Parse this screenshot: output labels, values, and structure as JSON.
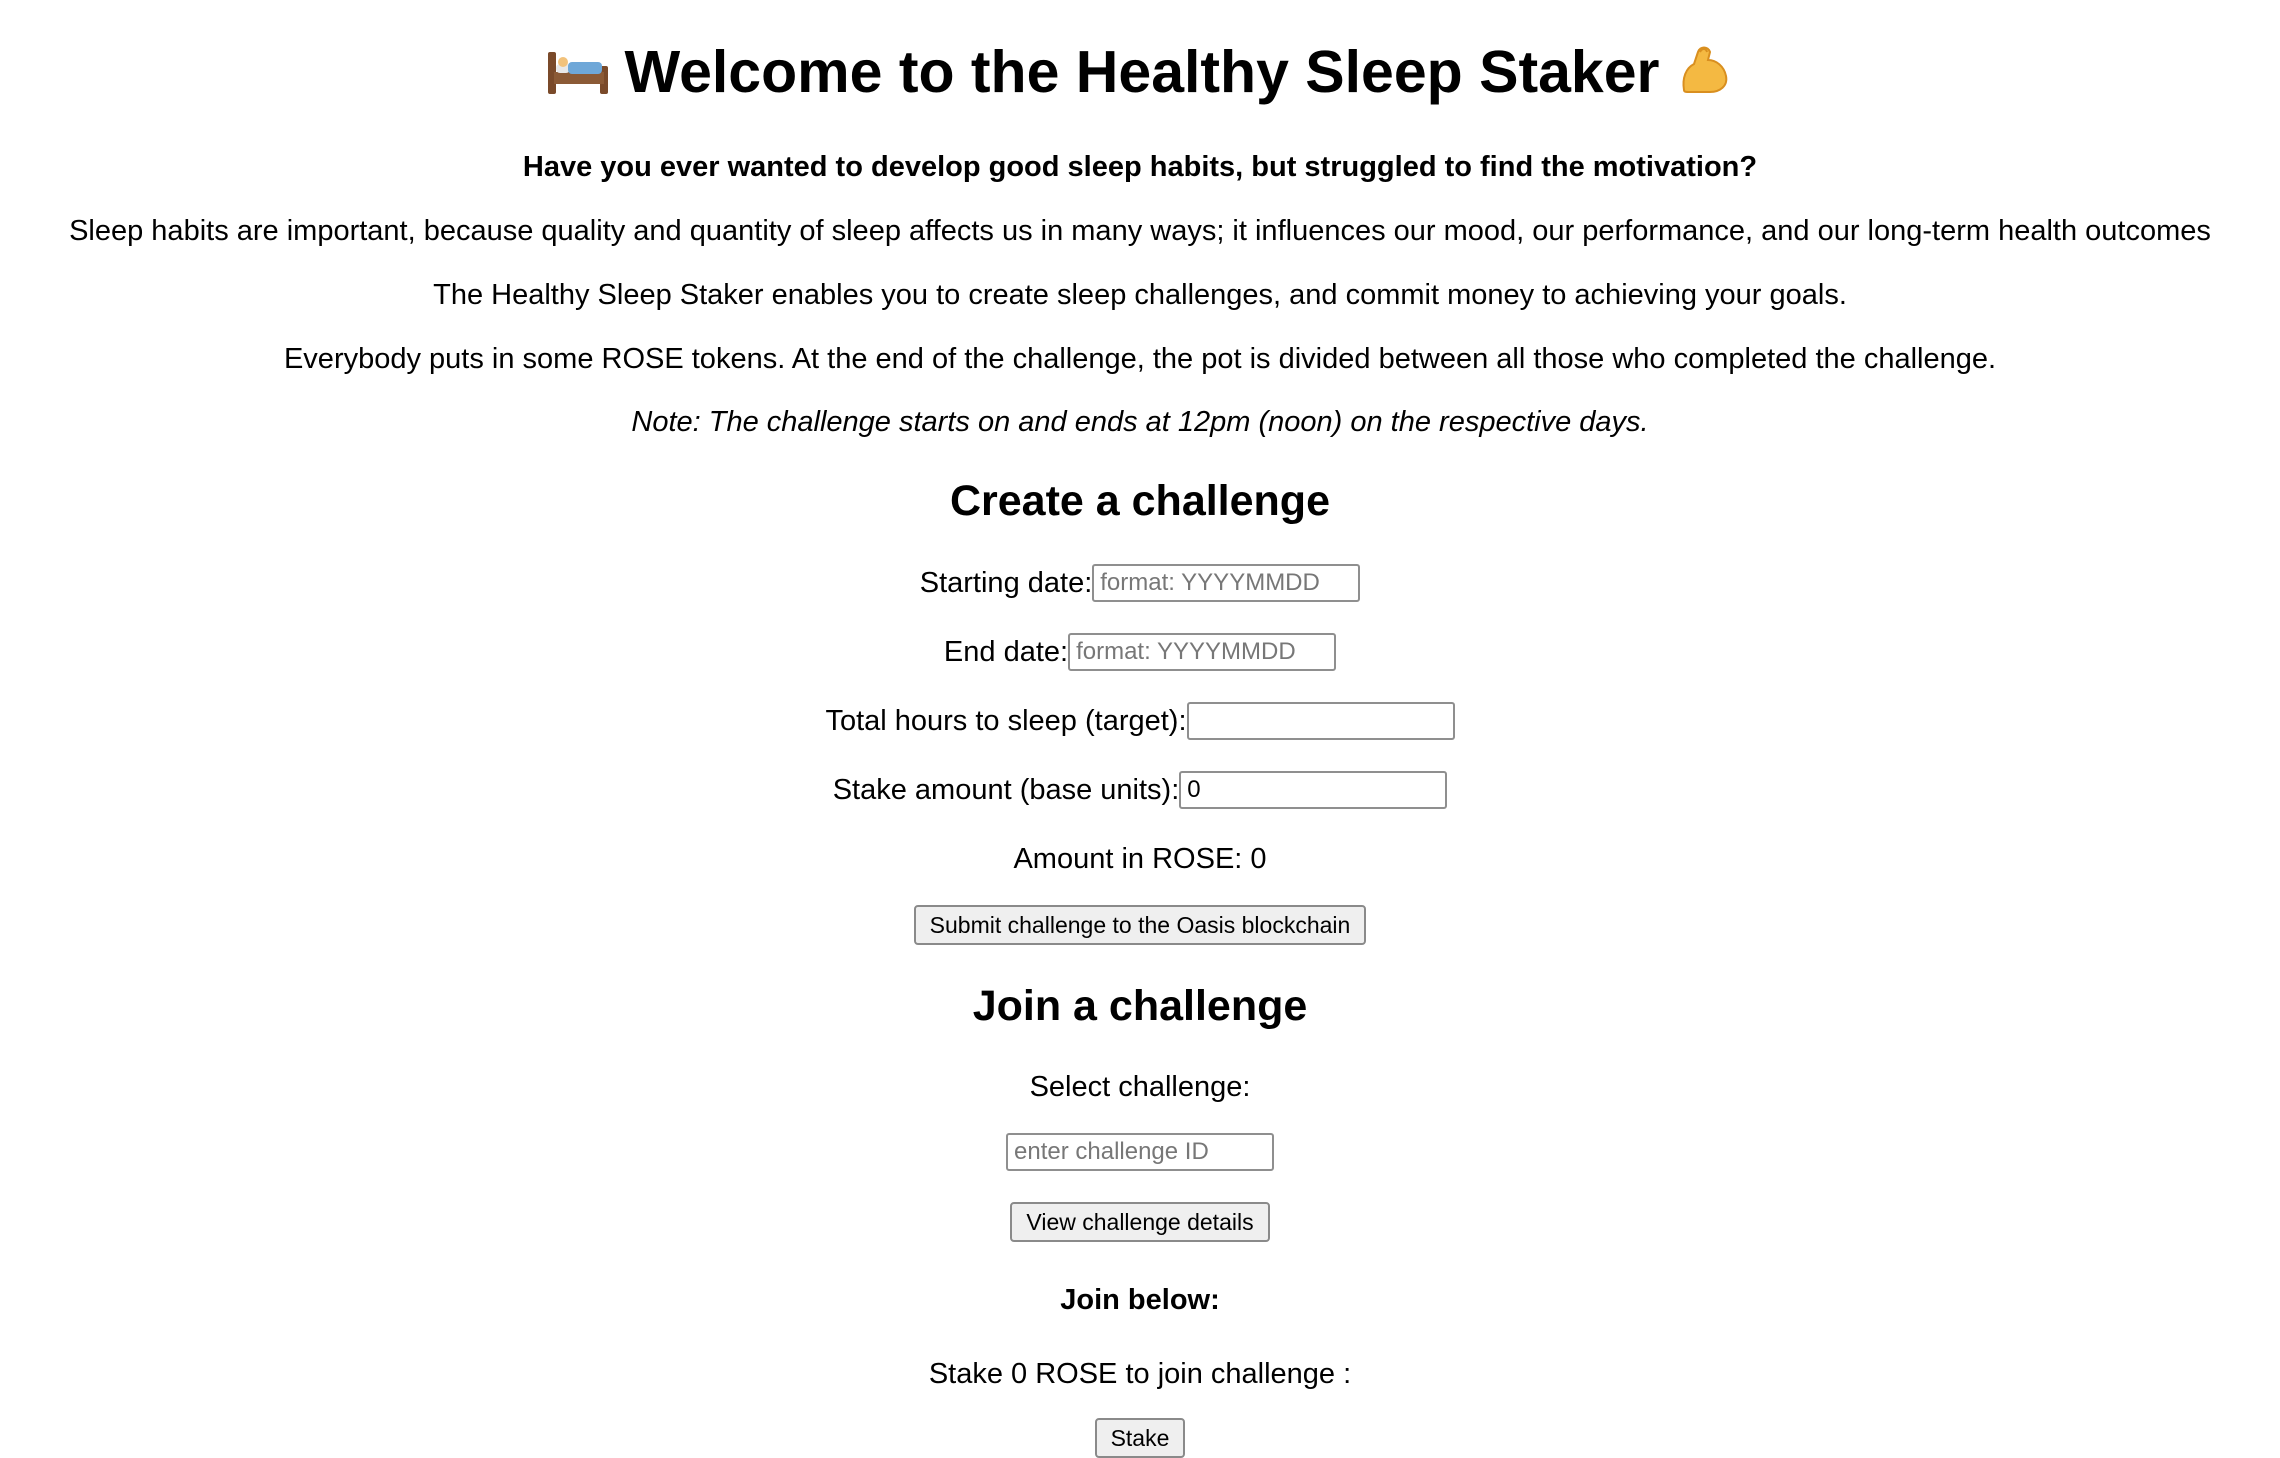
{
  "header": {
    "title": "Welcome to the Healthy Sleep Staker",
    "left_emoji": "bed-icon",
    "right_emoji": "flexed-biceps-icon"
  },
  "intro": {
    "lead": "Have you ever wanted to develop good sleep habits, but struggled to find the motivation?",
    "p1": "Sleep habits are important, because quality and quantity of sleep affects us in many ways; it influences our mood, our performance, and our long-term health outcomes",
    "p2": "The Healthy Sleep Staker enables you to create sleep challenges, and commit money to achieving your goals.",
    "p3": "Everybody puts in some ROSE tokens. At the end of the challenge, the pot is divided between all those who completed the challenge.",
    "note": "Note: The challenge starts on and ends at 12pm (noon) on the respective days."
  },
  "create": {
    "heading": "Create a challenge",
    "start_label": "Starting date:",
    "start_placeholder": "format: YYYYMMDD",
    "start_value": "",
    "end_label": "End date:",
    "end_placeholder": "format: YYYYMMDD",
    "end_value": "",
    "hours_label": "Total hours to sleep (target):",
    "hours_value": "",
    "stake_label": "Stake amount (base units):",
    "stake_value": "0",
    "amount_text": "Amount in ROSE: 0",
    "submit_label": "Submit challenge to the Oasis blockchain"
  },
  "join": {
    "heading": "Join a challenge",
    "select_label": "Select challenge:",
    "id_placeholder": "enter challenge ID",
    "id_value": "",
    "view_label": "View challenge details",
    "join_below": "Join below:",
    "stake_text": "Stake 0 ROSE to join challenge :",
    "stake_button": "Stake"
  },
  "colors": {
    "text": "#000000",
    "background": "#ffffff",
    "button_bg": "#efefef",
    "input_border": "#8f8f8f",
    "placeholder": "#777777"
  }
}
